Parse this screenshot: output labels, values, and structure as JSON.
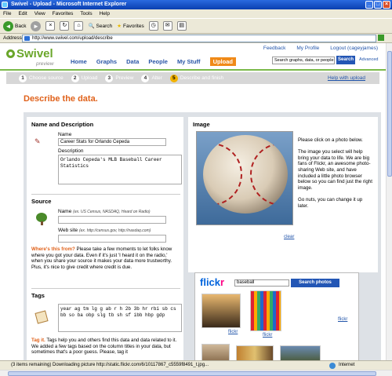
{
  "window": {
    "title": "Swivel - Upload - Microsoft Internet Explorer"
  },
  "menu": [
    "File",
    "Edit",
    "View",
    "Favorites",
    "Tools",
    "Help"
  ],
  "toolbar": {
    "back": "Back",
    "search": "Search",
    "favorites": "Favorites"
  },
  "address": {
    "label": "Address",
    "url": "http://www.swivel.com/upload/describe",
    "go": "Go"
  },
  "site": {
    "logo": "Swivel",
    "logo_sub": "preview",
    "top_links": [
      "Feedback",
      "My Profile",
      "Logout (cageyjames)"
    ],
    "nav": [
      "Home",
      "Graphs",
      "Data",
      "People",
      "My Stuff",
      "Upload"
    ],
    "search_placeholder": "Search graphs, data, or people",
    "search_button": "Search",
    "advanced": "Advanced"
  },
  "steps": [
    {
      "n": "1",
      "label": "Choose source"
    },
    {
      "n": "2",
      "label": "Upload"
    },
    {
      "n": "3",
      "label": "Preview"
    },
    {
      "n": "4",
      "label": "Alter"
    },
    {
      "n": "5",
      "label": "Describe and finish"
    }
  ],
  "help_link": "Help with upload",
  "page_title": "Describe the data.",
  "name_section": {
    "heading": "Name and Description",
    "name_label": "Name",
    "name_value": "Career Stats for Orlando Cepeda",
    "desc_label": "Description",
    "desc_value": "Orlando Cepeda's MLB Baseball Career Statistics"
  },
  "source_section": {
    "heading": "Source",
    "name_label": "Name",
    "name_hint": "(ex. US Census, NASDAQ, Heard on Radio)",
    "site_label": "Web site",
    "site_hint": "(ex. http://census.gov, http://nasdaq.com)",
    "note_title": "Where's this from?",
    "note_text": " Please take a few moments to let folks know where you got your data. Even if it's just 'I heard it on the radio,' when you share your source it makes your data more trustworthy. Plus, it's nice to give credit where credit is due."
  },
  "tags_section": {
    "heading": "Tags",
    "value": "year ag tm lg g ab r h 2b 3b hr rbi sb cs bb so ba obp slg tb sh sf ibb hbp gdp",
    "note_title": "Tag it.",
    "note_text": " Tags help you and others find this data and data related to it. We added a few tags based on the column titles in your data, but sometimes that's a poor guess. Please, tag it"
  },
  "image_section": {
    "heading": "Image",
    "instructions": [
      "Please click on a photo below.",
      "The image you select will help bring your data to life. We are big fans of Flickr, an awesome photo-sharing Web site, and have included a little photo browser below so you can find just the right image.",
      "Go nuts, you can change it up later."
    ],
    "clear": "clear"
  },
  "flickr": {
    "logo_a": "flick",
    "logo_b": "r",
    "query": "baseball",
    "button": "Search photos",
    "link": "flickr"
  },
  "status": {
    "text": "(3 items remaining) Downloading picture http://static.flickr.com/6/10117867_c5559f8491_t.jpg...",
    "zone": "Internet"
  },
  "colors": {
    "accent": "#e0621b",
    "brand_green": "#6aa62a",
    "link": "#2255aa",
    "button": "#2356b5"
  }
}
